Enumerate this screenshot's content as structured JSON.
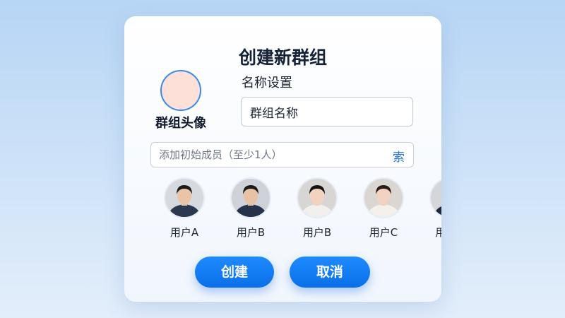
{
  "dialog": {
    "title": "创建新群组",
    "avatar_label": "群组头像",
    "name_section_label": "名称设置",
    "name_input_value": "群组名称",
    "search_placeholder": "添加初始成员（至少1人）",
    "search_button": "索"
  },
  "members": [
    {
      "name": "用户A",
      "shirt": "#2b3950",
      "hair": "#1b1b1b",
      "skin": "#e9c4a6",
      "bg": "#d6d9de",
      "icon": "member-avatar-icon"
    },
    {
      "name": "用户B",
      "shirt": "#24324a",
      "hair": "#1a1a1a",
      "skin": "#e8c2a4",
      "bg": "#cfd3d9",
      "icon": "member-avatar-icon"
    },
    {
      "name": "用户B",
      "shirt": "#f2f0ec",
      "hair": "#141414",
      "skin": "#f3d3c0",
      "bg": "#d8d6d4",
      "icon": "member-avatar-icon"
    },
    {
      "name": "用户C",
      "shirt": "#f4f1ec",
      "hair": "#2a1d16",
      "skin": "#f2d2c0",
      "bg": "#dad7d3",
      "icon": "member-avatar-icon"
    },
    {
      "name": "用户D",
      "shirt": "#1f2838",
      "hair": "#1a1410",
      "skin": "#efcdb6",
      "bg": "#d4d6da",
      "icon": "member-avatar-icon"
    }
  ],
  "buttons": {
    "create": "创建",
    "cancel": "取消"
  },
  "colors": {
    "accent": "#0a6fe8",
    "avatar_placeholder": "#fde0d8",
    "avatar_border": "#3e88ec"
  }
}
